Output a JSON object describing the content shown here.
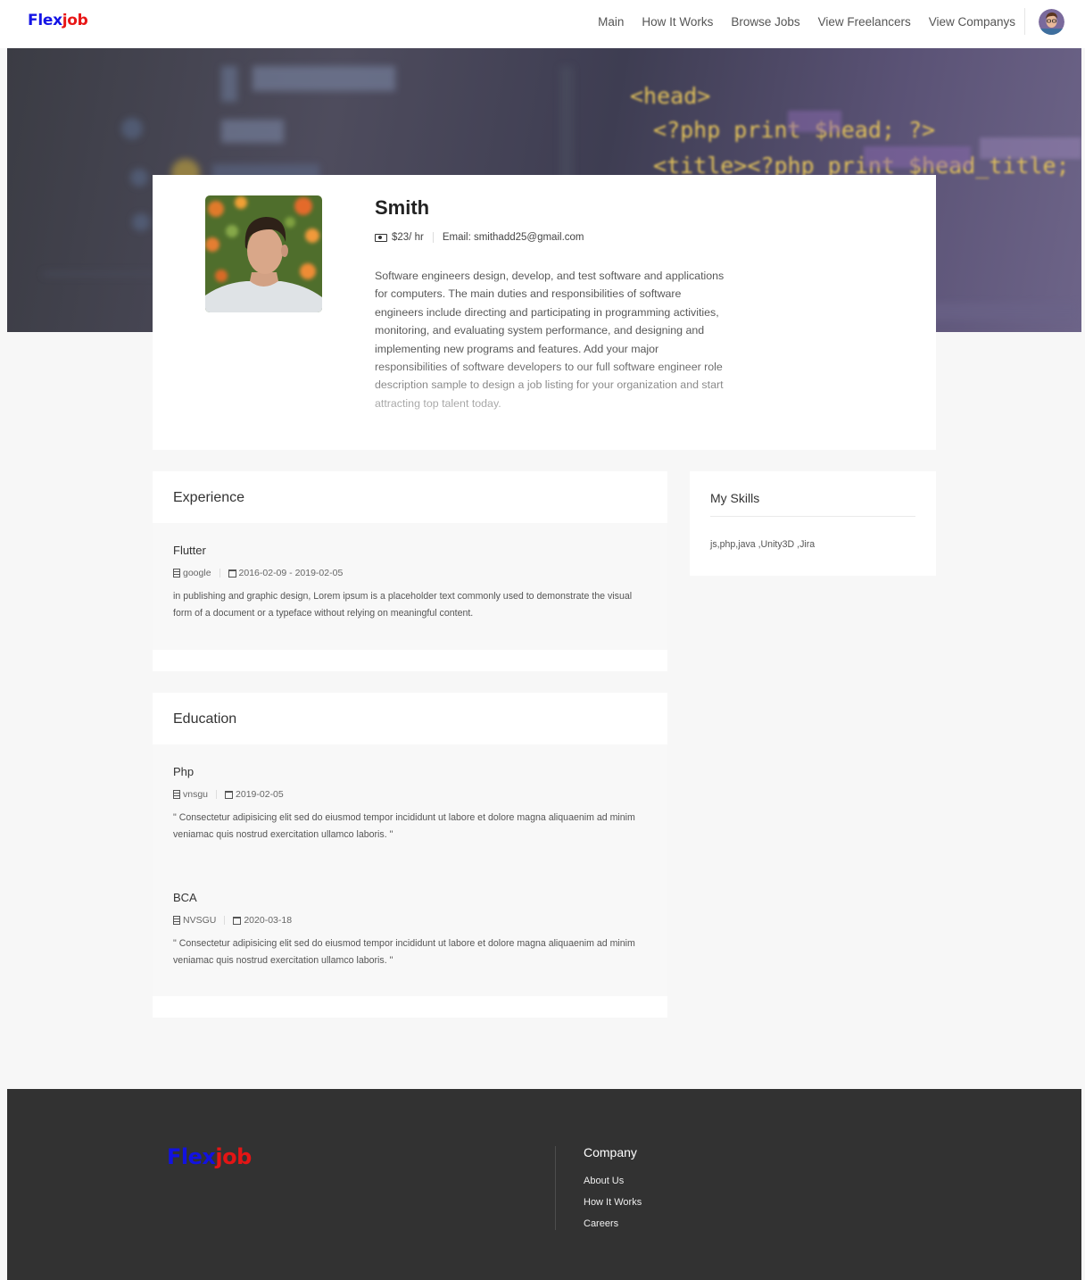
{
  "header": {
    "logo": {
      "flex": "Flex",
      "job": "job"
    },
    "nav": [
      "Main",
      "How It Works",
      "Browse Jobs",
      "View Freelancers",
      "View Companys"
    ],
    "avatar_icon": "user-avatar"
  },
  "banner": {
    "code_lines": [
      "<head>",
      "<?php print $head; ?>",
      "<title><?php print $head_title; ?></title>"
    ]
  },
  "profile": {
    "name": "Smith",
    "rate": "$23/ hr",
    "email": "Email: smithadd25@gmail.com",
    "bio": "Software engineers design, develop, and test software and applications for computers. The main duties and responsibilities of software engineers include directing and participating in programming activities, monitoring, and evaluating system performance, and designing and implementing new programs and features. Add your major responsibilities of software developers to our full software engineer role description sample to design a job listing for your organization and start attracting top talent today."
  },
  "experience": {
    "title": "Experience",
    "items": [
      {
        "title": "Flutter",
        "company": "google",
        "dates": "2016-02-09 - 2019-02-05",
        "desc": "in publishing and graphic design, Lorem ipsum is a placeholder text commonly used to demonstrate the visual form of a document or a typeface without relying on meaningful content."
      }
    ]
  },
  "education": {
    "title": "Education",
    "items": [
      {
        "title": "Php",
        "school": "vnsgu",
        "date": "2019-02-05",
        "desc": "\" Consectetur adipisicing elit sed do eiusmod tempor incididunt ut labore et dolore magna aliquaenim ad minim veniamac quis nostrud exercitation ullamco laboris. \""
      },
      {
        "title": "BCA",
        "school": "NVSGU",
        "date": "2020-03-18",
        "desc": "\" Consectetur adipisicing elit sed do eiusmod tempor incididunt ut labore et dolore magna aliquaenim ad minim veniamac quis nostrud exercitation ullamco laboris. \""
      }
    ]
  },
  "skills": {
    "title": "My Skills",
    "text": "js,php,java ,Unity3D ,Jira"
  },
  "footer": {
    "logo": {
      "flex": "Flex",
      "job": "job"
    },
    "company_heading": "Company",
    "links": [
      "About Us",
      "How It Works",
      "Careers"
    ]
  },
  "colors": {
    "logo_flex": "#1414e6",
    "logo_job": "#e81616",
    "footer_bg": "#323232",
    "page_bg": "#f7f7f7"
  }
}
